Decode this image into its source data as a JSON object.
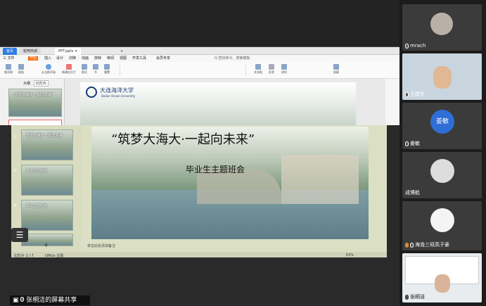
{
  "wps": {
    "tabs": [
      {
        "label": "首页"
      },
      {
        "label": "稻壳商城"
      },
      {
        "label": "PPT.pptx"
      }
    ],
    "menu": [
      "三 文件",
      "开始",
      "插入",
      "设计",
      "切换",
      "动画",
      "放映",
      "审阅",
      "视图",
      "开发工具",
      "会员专享"
    ],
    "search": "Q 查找命令、搜索模板",
    "sidebar_tabs": [
      "大纲",
      "幻灯片"
    ],
    "thumb1": "“筑梦大海大·一起向未来”",
    "logo_cn": "大连海洋大学",
    "logo_en": "Dalian Ocean University",
    "ribbon_labels": [
      "格式刷",
      "粘贴",
      "从当前开始",
      "新建幻灯片",
      "版式",
      "节",
      "重置",
      "文本框",
      "形状",
      "排列",
      "轮廓"
    ]
  },
  "share": {
    "slide_title": "“筑梦大海大·一起向未来”",
    "slide_subtitle": "毕业生主题班会",
    "thumbs": [
      {
        "num": "2",
        "title": "筑梦大海大 一起向未来"
      },
      {
        "num": "3",
        "title": "本次主题班会"
      },
      {
        "num": "4",
        "title": "本次主题班会"
      },
      {
        "num": "5",
        "title": ""
      }
    ],
    "status_left": "幻灯片 2 / 7",
    "status_theme": "Office 主题",
    "notes": "单击此处添加备注",
    "zoom": "63%",
    "share_label": "张桐洁的屏幕共享"
  },
  "participants": [
    {
      "name": "mrach"
    },
    {
      "name": "王建东"
    },
    {
      "name": "姜敏",
      "initials": "姜敏"
    },
    {
      "name": "成博航"
    },
    {
      "name": "海渔三班高子豪"
    },
    {
      "name": "张桐洁"
    }
  ],
  "colors": {
    "accent": "#2d7be5",
    "avatar_blue": "#2f6ed6"
  }
}
